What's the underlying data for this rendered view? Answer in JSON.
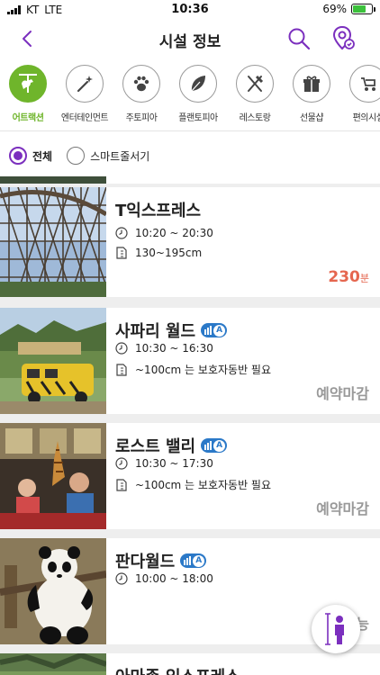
{
  "status_bar": {
    "carrier": "KT",
    "network": "LTE",
    "time": "10:36",
    "battery": "69%",
    "battery_level": 0.69
  },
  "header": {
    "title": "시설 정보",
    "back_icon": "chevron-left-icon",
    "search_icon": "search-icon",
    "map_icon": "location-pin-icon"
  },
  "categories": [
    {
      "label": "어트랙션",
      "icon": "carousel-horse-icon",
      "active": true
    },
    {
      "label": "엔터테인먼트",
      "icon": "magic-wand-icon",
      "active": false
    },
    {
      "label": "주토피아",
      "icon": "paw-icon",
      "active": false
    },
    {
      "label": "플랜토피아",
      "icon": "leaf-icon",
      "active": false
    },
    {
      "label": "레스토랑",
      "icon": "fork-knife-icon",
      "active": false
    },
    {
      "label": "선물샵",
      "icon": "gift-icon",
      "active": false
    },
    {
      "label": "편의시설",
      "icon": "stroller-icon",
      "active": false
    }
  ],
  "filter": {
    "options": [
      "전체",
      "스마트줄서기"
    ],
    "selected": "전체"
  },
  "attractions": [
    {
      "name": "T익스프레스",
      "hours": "10:20 ~ 20:30",
      "height": "130~195cm",
      "wait": "230",
      "wait_unit": "분",
      "status": "",
      "accessibility_badge": false
    },
    {
      "name": "사파리 월드",
      "hours": "10:30 ~ 16:30",
      "height": "~100cm 는 보호자동반 필요",
      "wait": "",
      "wait_unit": "",
      "status": "예약마감",
      "accessibility_badge": true
    },
    {
      "name": "로스트 밸리",
      "hours": "10:30 ~ 17:30",
      "height": "~100cm 는 보호자동반 필요",
      "wait": "",
      "wait_unit": "",
      "status": "예약마감",
      "accessibility_badge": true
    },
    {
      "name": "판다월드",
      "hours": "10:00 ~ 18:00",
      "height": "",
      "wait": "",
      "wait_unit": "",
      "status": "예약가능",
      "accessibility_badge": true
    },
    {
      "name": "아마존 익스프레스",
      "hours": "",
      "height": "",
      "wait": "",
      "wait_unit": "",
      "status": "",
      "accessibility_badge": false
    }
  ],
  "float_button": {
    "icon": "height-person-icon"
  },
  "colors": {
    "accent": "#7b2fbe",
    "active_category": "#6fb52b",
    "wait_time": "#e5664f",
    "badge": "#2b79c8"
  }
}
